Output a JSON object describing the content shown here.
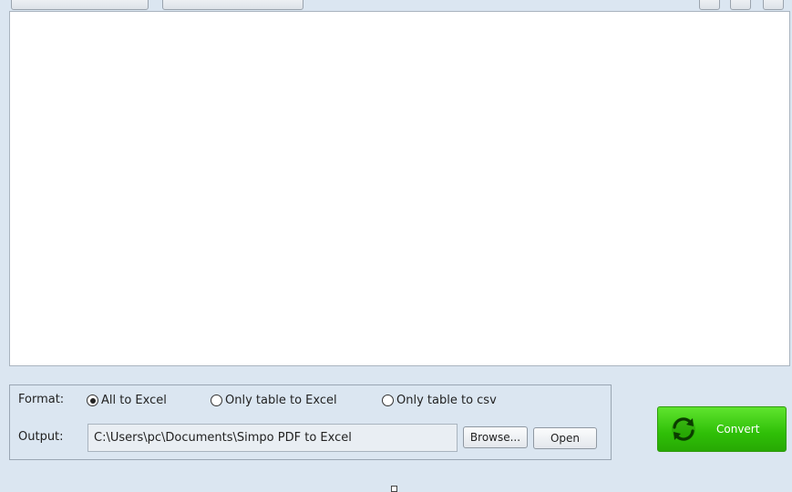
{
  "format": {
    "label": "Format:",
    "options": [
      {
        "label": "All to Excel",
        "checked": true
      },
      {
        "label": "Only table to Excel",
        "checked": false
      },
      {
        "label": "Only table to csv",
        "checked": false
      }
    ]
  },
  "output": {
    "label": "Output:",
    "path": "C:\\Users\\pc\\Documents\\Simpo PDF to Excel",
    "browse_label": "Browse...",
    "open_label": "Open"
  },
  "convert": {
    "label": "Convert",
    "icon": "refresh-icon",
    "color": "#3cc70e"
  },
  "colors": {
    "window_bg": "#dbe6f1",
    "panel_border": "#9aa6b3"
  }
}
